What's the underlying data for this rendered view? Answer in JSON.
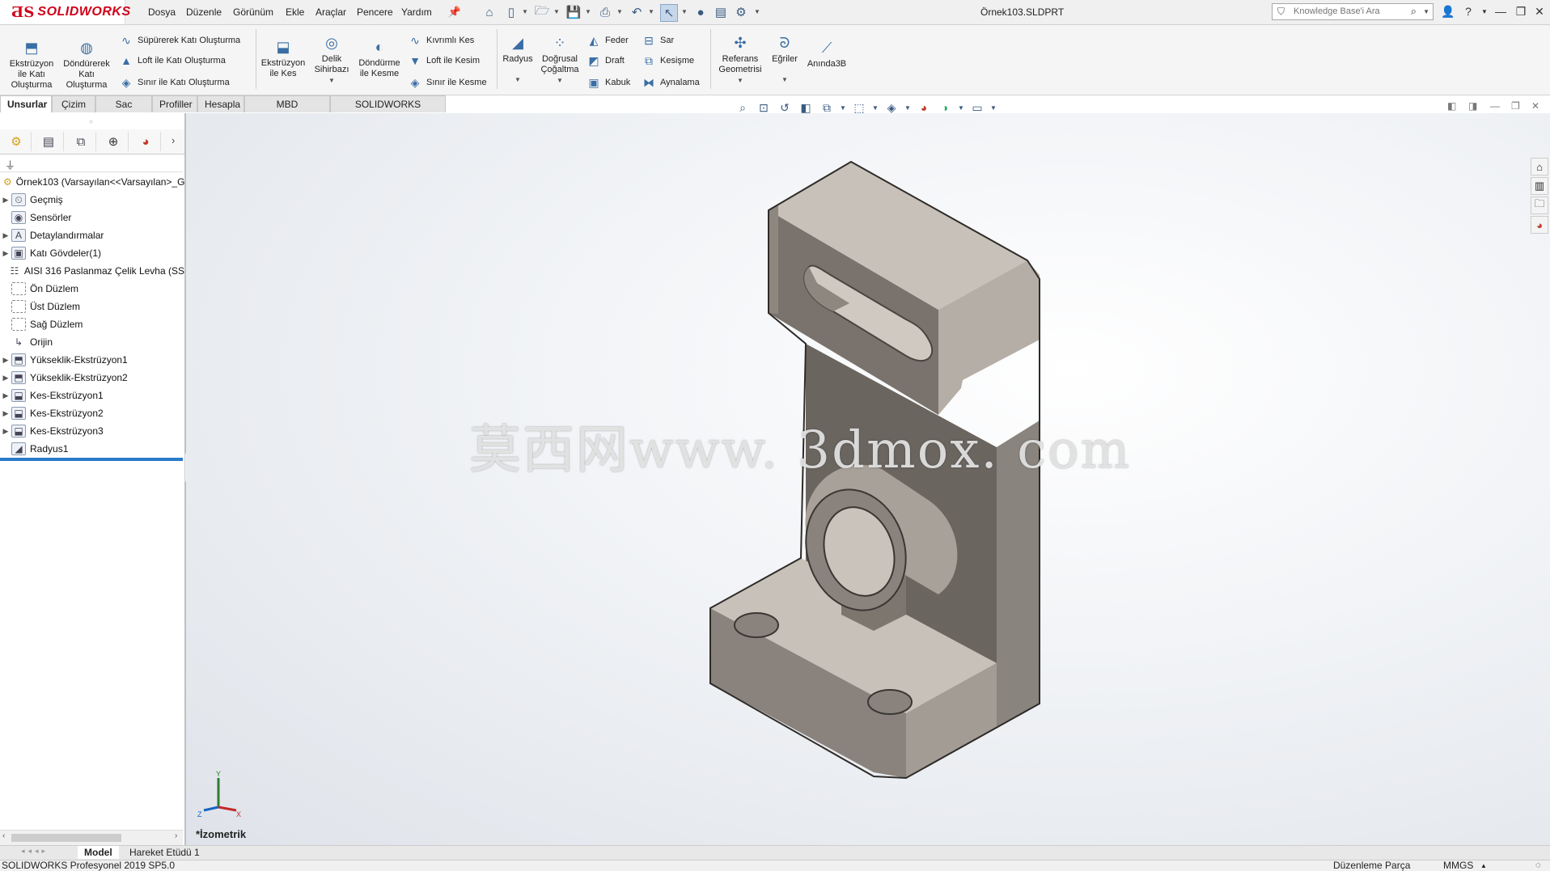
{
  "app": {
    "brand": "SOLIDWORKS",
    "doc_title": "Örnek103.SLDPRT"
  },
  "menu": [
    "Dosya",
    "Düzenle",
    "Görünüm",
    "Ekle",
    "Araçlar",
    "Pencere",
    "Yardım"
  ],
  "search": {
    "placeholder": "Knowledge Base'i Ara"
  },
  "commands": {
    "extrude_boss": "Ekstrüzyon ile Katı Oluşturma",
    "revolve_boss": "Döndürerek Katı Oluşturma",
    "sweep_boss": "Süpürerek Katı Oluşturma",
    "loft_boss": "Loft ile Katı Oluşturma",
    "boundary_boss": "Sınır ile Katı Oluşturma",
    "extrude_cut": "Ekstrüzyon ile Kes",
    "hole_wizard": "Delik Sihirbazı",
    "revolve_cut": "Döndürme ile Kesme",
    "swept_cut": "Kıvrımlı Kes",
    "loft_cut": "Loft ile Kesim",
    "boundary_cut": "Sınır ile Kesme",
    "fillet": "Radyus",
    "linear_pattern": "Doğrusal Çoğaltma",
    "rib": "Feder",
    "draft": "Draft",
    "shell": "Kabuk",
    "wrap": "Sar",
    "intersect": "Kesişme",
    "mirror": "Aynalama",
    "ref_geometry": "Referans Geometrisi",
    "curves": "Eğriler",
    "instant3d": "Anında3B"
  },
  "tabs": [
    "Unsurlar",
    "Çizim",
    "Sac Levha",
    "Profiller",
    "Hesapla",
    "MBD Dimensions",
    "SOLIDWORKS Eklentileri"
  ],
  "active_tab": "Unsurlar",
  "tree": {
    "root": "Örnek103  (Varsayılan<<Varsayılan>_G",
    "items": [
      {
        "label": "Geçmiş",
        "expandable": true,
        "icon": "history-icon"
      },
      {
        "label": "Sensörler",
        "expandable": false,
        "icon": "sensor-icon"
      },
      {
        "label": "Detaylandırmalar",
        "expandable": true,
        "icon": "annotation-icon"
      },
      {
        "label": "Katı Gövdeler(1)",
        "expandable": true,
        "icon": "solid-bodies-icon"
      },
      {
        "label": "AISI 316 Paslanmaz Çelik Levha (SS",
        "expandable": false,
        "icon": "material-icon"
      },
      {
        "label": "Ön Düzlem",
        "expandable": false,
        "icon": "plane-icon"
      },
      {
        "label": "Üst Düzlem",
        "expandable": false,
        "icon": "plane-icon"
      },
      {
        "label": "Sağ Düzlem",
        "expandable": false,
        "icon": "plane-icon"
      },
      {
        "label": "Orijin",
        "expandable": false,
        "icon": "origin-icon"
      },
      {
        "label": "Yükseklik-Ekstrüzyon1",
        "expandable": true,
        "icon": "boss-extrude-icon"
      },
      {
        "label": "Yükseklik-Ekstrüzyon2",
        "expandable": true,
        "icon": "boss-extrude-icon"
      },
      {
        "label": "Kes-Ekstrüzyon1",
        "expandable": true,
        "icon": "cut-extrude-icon"
      },
      {
        "label": "Kes-Ekstrüzyon2",
        "expandable": true,
        "icon": "cut-extrude-icon"
      },
      {
        "label": "Kes-Ekstrüzyon3",
        "expandable": true,
        "icon": "cut-extrude-icon"
      },
      {
        "label": "Radyus1",
        "expandable": false,
        "icon": "fillet-icon"
      }
    ]
  },
  "viewport": {
    "view_name": "*İzometrik",
    "watermark": "莫西网www. 3dmox. com",
    "part_color": "#c9c3bb",
    "axis_labels": {
      "x": "X",
      "y": "Y",
      "z": "Z"
    }
  },
  "bottom_tabs": [
    "Model",
    "Hareket Etüdü 1"
  ],
  "status": {
    "version": "SOLIDWORKS Profesyonel 2019 SP5.0",
    "mode": "Düzenleme Parça",
    "units": "MMGS"
  },
  "colors": {
    "brand_red": "#d0021b",
    "accent_blue": "#2b7bc9"
  }
}
